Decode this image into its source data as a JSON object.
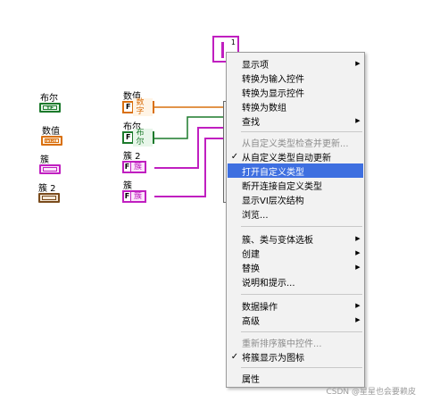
{
  "colors": {
    "bool": "#1c7a2c",
    "numeric": "#d9700f",
    "cluster": "#c01fc0",
    "cluster_alt": "#7a4b1c",
    "menu_highlight": "#3e6fe0"
  },
  "terminals": [
    {
      "label": "布尔",
      "glyph": "TF"
    },
    {
      "label": "数值",
      "glyph": "DBL"
    },
    {
      "label": "簇",
      "glyph": ""
    },
    {
      "label": "簇 2",
      "glyph": ""
    }
  ],
  "constants": [
    {
      "label": "数值",
      "text": "数字",
      "glyph": "F"
    },
    {
      "label": "布尔",
      "text": "布尔",
      "glyph": "F"
    },
    {
      "label": "簇 2",
      "text": "簇",
      "glyph": "F"
    },
    {
      "label": "簇",
      "text": "簇",
      "glyph": "F"
    }
  ],
  "cluster_indicator": {
    "count": "1"
  },
  "context_menu": {
    "items": [
      {
        "label": "显示项",
        "arrow": "▶",
        "check": "",
        "state": "normal"
      },
      {
        "label": "转换为输入控件",
        "arrow": "",
        "check": "",
        "state": "normal"
      },
      {
        "label": "转换为显示控件",
        "arrow": "",
        "check": "",
        "state": "normal"
      },
      {
        "label": "转换为数组",
        "arrow": "",
        "check": "",
        "state": "normal"
      },
      {
        "label": "查找",
        "arrow": "▶",
        "check": "",
        "state": "normal"
      },
      {
        "label": "从自定义类型检查并更新...",
        "arrow": "",
        "check": "",
        "state": "disabled"
      },
      {
        "label": "从自定义类型自动更新",
        "arrow": "",
        "check": "✓",
        "state": "normal"
      },
      {
        "label": "打开自定义类型",
        "arrow": "",
        "check": "",
        "state": "highlighted"
      },
      {
        "label": "断开连接自定义类型",
        "arrow": "",
        "check": "",
        "state": "normal"
      },
      {
        "label": "显示VI层次结构",
        "arrow": "",
        "check": "",
        "state": "normal"
      },
      {
        "label": "浏览...",
        "arrow": "",
        "check": "",
        "state": "normal"
      },
      {
        "label": "簇、类与变体选板",
        "arrow": "▶",
        "check": "",
        "state": "normal"
      },
      {
        "label": "创建",
        "arrow": "▶",
        "check": "",
        "state": "normal"
      },
      {
        "label": "替换",
        "arrow": "▶",
        "check": "",
        "state": "normal"
      },
      {
        "label": "说明和提示...",
        "arrow": "",
        "check": "",
        "state": "normal"
      },
      {
        "label": "数据操作",
        "arrow": "▶",
        "check": "",
        "state": "normal"
      },
      {
        "label": "高级",
        "arrow": "▶",
        "check": "",
        "state": "normal"
      },
      {
        "label": "重新排序簇中控件...",
        "arrow": "",
        "check": "",
        "state": "disabled"
      },
      {
        "label": "将簇显示为图标",
        "arrow": "",
        "check": "✓",
        "state": "normal"
      },
      {
        "label": "属性",
        "arrow": "",
        "check": "",
        "state": "normal"
      }
    ]
  },
  "watermark": "CSDN @星星也会要赖皮"
}
